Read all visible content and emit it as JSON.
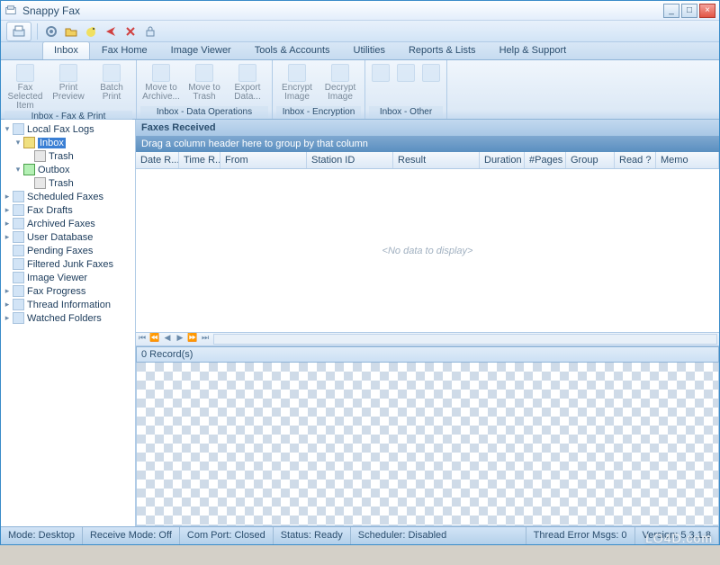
{
  "window": {
    "title": "Snappy Fax"
  },
  "tabs": [
    "Inbox",
    "Fax Home",
    "Image Viewer",
    "Tools & Accounts",
    "Utilities",
    "Reports & Lists",
    "Help & Support"
  ],
  "ribbon": {
    "g1": {
      "label": "Inbox - Fax & Print",
      "b1a": "Fax Selected",
      "b1b": "Item",
      "b2a": "Print",
      "b2b": "Preview",
      "b3a": "Batch",
      "b3b": "Print"
    },
    "g2": {
      "label": "Inbox - Data Operations",
      "b1a": "Move to",
      "b1b": "Archive...",
      "b2a": "Move to",
      "b2b": "Trash",
      "b3a": "Export",
      "b3b": "Data..."
    },
    "g3": {
      "label": "Inbox - Encryption",
      "b1a": "Encrypt",
      "b1b": "Image",
      "b2a": "Decrypt",
      "b2b": "Image"
    },
    "g4": {
      "label": "Inbox - Other"
    }
  },
  "tree": {
    "root": "Local Fax Logs",
    "inbox": "Inbox",
    "trash": "Trash",
    "outbox": "Outbox",
    "scheduled": "Scheduled Faxes",
    "drafts": "Fax Drafts",
    "archived": "Archived Faxes",
    "userdb": "User Database",
    "pending": "Pending Faxes",
    "filtered": "Filtered Junk Faxes",
    "viewer": "Image Viewer",
    "progress": "Fax Progress",
    "thread": "Thread Information",
    "watched": "Watched Folders"
  },
  "grid": {
    "title": "Faxes Received",
    "grouphint": "Drag a column header here to group by that column",
    "cols": {
      "date": "Date R...",
      "time": "Time R...",
      "from": "From",
      "station": "Station ID",
      "result": "Result",
      "duration": "Duration",
      "pages": "#Pages",
      "group": "Group",
      "read": "Read ?",
      "memo": "Memo"
    },
    "empty": "<No data to display>",
    "records": "0 Record(s)"
  },
  "status": {
    "mode": "Mode: Desktop",
    "receive": "Receive Mode: Off",
    "com": "Com Port: Closed",
    "ready": "Status: Ready",
    "sched": "Scheduler: Disabled",
    "thread": "Thread Error Msgs: 0",
    "ver": "Version: 5.3.1.8"
  },
  "watermark": "LO4D.com"
}
